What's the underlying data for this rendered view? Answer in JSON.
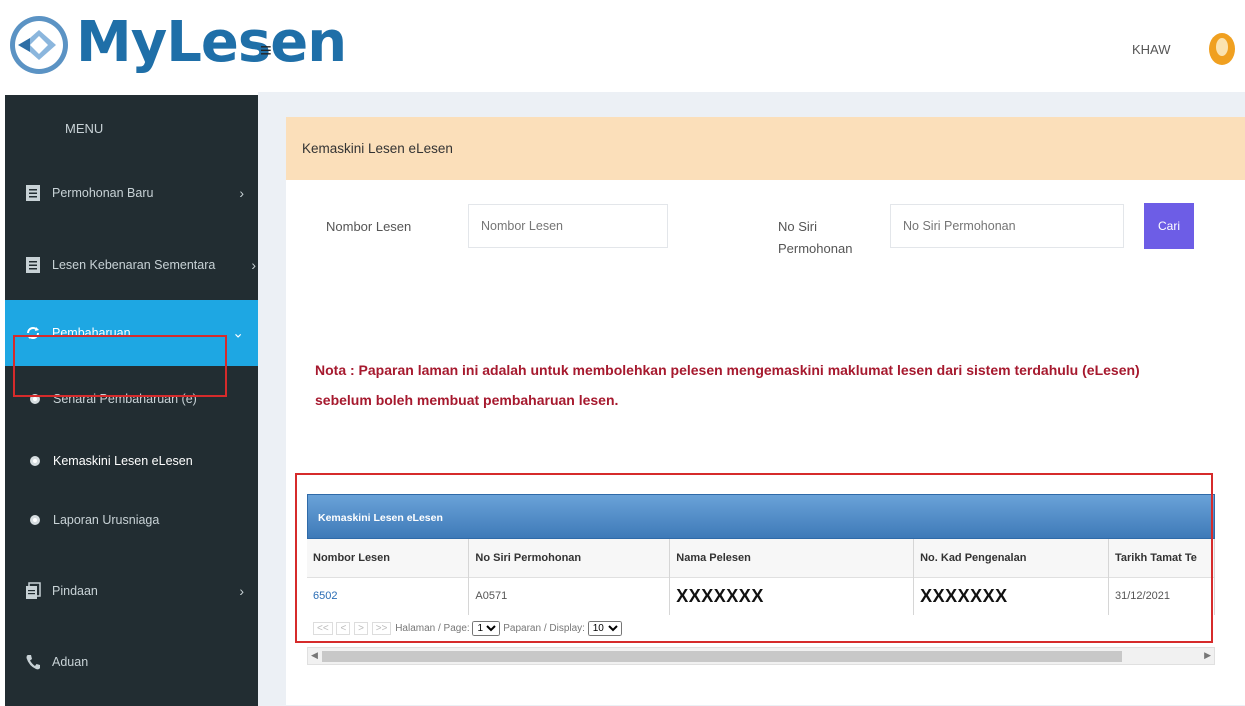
{
  "header": {
    "app_name": "MyLesen",
    "menu_toggle": "≡",
    "user": "KHAW"
  },
  "sidebar": {
    "menu_title": "MENU",
    "items": [
      {
        "label": "Permohonan Baru",
        "icon": "document-icon",
        "chevron": "›"
      },
      {
        "label": "Lesen Kebenaran Sementara",
        "icon": "document-icon",
        "chevron": "›"
      },
      {
        "label": "Pembaharuan",
        "icon": "refresh-icon",
        "chevron": "⌄"
      },
      {
        "label": "Senarai Pembaharuan (e)",
        "icon": "circle-icon"
      },
      {
        "label": "Kemaskini Lesen eLesen",
        "icon": "circle-icon"
      },
      {
        "label": "Laporan Urusniaga",
        "icon": "circle-icon"
      },
      {
        "label": "Pindaan",
        "icon": "copy-icon",
        "chevron": "›"
      },
      {
        "label": "Aduan",
        "icon": "phone-icon"
      }
    ]
  },
  "panel": {
    "title": "Kemaskini Lesen eLesen",
    "field1_label": "Nombor Lesen",
    "field1_placeholder": "Nombor Lesen",
    "field2_label_line1": "No Siri",
    "field2_label_line2": "Permohonan",
    "field2_placeholder": "No Siri Permohonan",
    "search_button": "Cari",
    "note_line1": "Nota : Paparan laman ini adalah untuk membolehkan pelesen mengemaskini maklumat lesen dari sistem terdahulu (eLesen)",
    "note_line2": "sebelum boleh membuat pembaharuan lesen."
  },
  "grid": {
    "caption": "Kemaskini Lesen eLesen",
    "columns": [
      "Nombor Lesen",
      "No Siri Permohonan",
      "Nama Pelesen",
      "No. Kad Pengenalan",
      "Tarikh Tamat Te"
    ],
    "row": [
      "6502",
      "A0571",
      "XXXXXXX",
      "XXXXXXX",
      "31/12/2021"
    ],
    "pager": {
      "nav_first": "<<",
      "nav_prev": "<",
      "nav_next": ">",
      "nav_last": ">>",
      "page_label": "Halaman / Page:",
      "page_value": "1",
      "display_label": "Paparan / Display:",
      "display_value": "10"
    }
  },
  "colors": {
    "sidebar_bg": "#222d32",
    "active_item": "#1ea7e3",
    "panel_header": "#fbdfba",
    "button": "#6d5de6",
    "note_text": "#a6192e",
    "highlight_border": "#d62b2b"
  }
}
